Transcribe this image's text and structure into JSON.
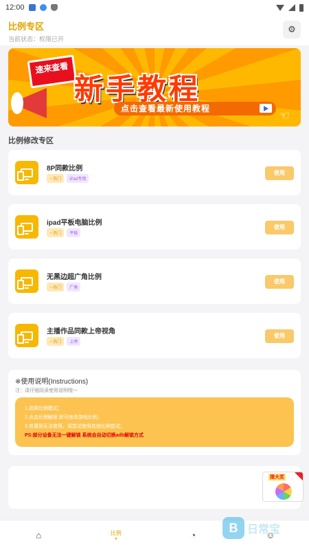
{
  "status_bar": {
    "time": "12:00"
  },
  "header": {
    "title": "比例专区",
    "subtitle": "当前状态：权限已开",
    "settings_icon": "gear-icon"
  },
  "banner": {
    "badge_text": "速来查看",
    "title": "新手教程",
    "subtitle": "点击查看最新使用教程",
    "colors": {
      "bg": "#ffb800",
      "title": "#ff3a00",
      "pill": "#f36a00"
    }
  },
  "section_title": "比例修改专区",
  "items": [
    {
      "title": "8P同款比例",
      "hot_tag": "热门",
      "category_tag": "iPad专用",
      "button": "使用"
    },
    {
      "title": "ipad平板电脑比例",
      "hot_tag": "热门",
      "category_tag": "平板",
      "button": "使用"
    },
    {
      "title": "无黑边超广角比例",
      "hot_tag": "热门",
      "category_tag": "广角",
      "button": "使用"
    },
    {
      "title": "主播作品同款上帝视角",
      "hot_tag": "热门",
      "category_tag": "上帝",
      "button": "使用"
    }
  ],
  "instructions": {
    "title": "※使用说明(Instructions)",
    "note": "注：请仔细阅读使用说明哦～",
    "steps": [
      "1.选择比例模式；",
      "2.点击比例解锁 即可修改游戏比例；",
      "3.若遇到无法使用，请尝试使用其他比例尝试；"
    ],
    "ps": "PS:部分设备无法一键解锁 系统会自动切换adb解锁方式"
  },
  "ad": {
    "label": "猜大奖"
  },
  "watermark": {
    "text": "日常宝"
  },
  "tabs": [
    {
      "label": "",
      "icon": "home-icon"
    },
    {
      "label": "比例",
      "icon": ""
    },
    {
      "label": "",
      "icon": "gauge-icon"
    },
    {
      "label": "",
      "icon": "profile-icon"
    }
  ],
  "accent": "#e3a400"
}
